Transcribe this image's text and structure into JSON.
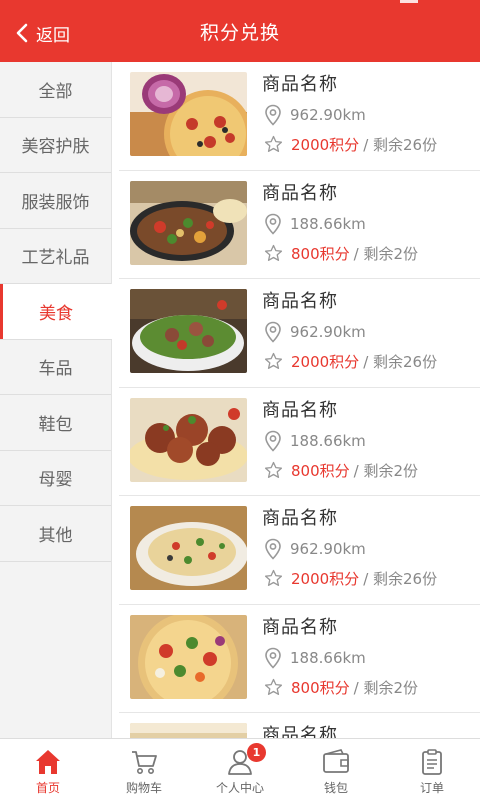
{
  "header": {
    "back_label": "返回",
    "title": "积分兑换"
  },
  "sidebar": {
    "items": [
      {
        "label": "全部"
      },
      {
        "label": "美容护肤"
      },
      {
        "label": "服装服饰"
      },
      {
        "label": "工艺礼品"
      },
      {
        "label": "美食",
        "active": true
      },
      {
        "label": "车品"
      },
      {
        "label": "鞋包"
      },
      {
        "label": "母婴"
      },
      {
        "label": "其他"
      }
    ]
  },
  "products": [
    {
      "name": "商品名称",
      "distance": "962.90km",
      "points": "2000积分",
      "stock": "/ 剩余26份",
      "image": "pizza-onion"
    },
    {
      "name": "商品名称",
      "distance": "188.66km",
      "points": "800积分",
      "stock": "/ 剩余2份",
      "image": "pan-stirfry"
    },
    {
      "name": "商品名称",
      "distance": "962.90km",
      "points": "2000积分",
      "stock": "/ 剩余26份",
      "image": "salad-bowl"
    },
    {
      "name": "商品名称",
      "distance": "188.66km",
      "points": "800积分",
      "stock": "/ 剩余2份",
      "image": "meatball-pasta"
    },
    {
      "name": "商品名称",
      "distance": "962.90km",
      "points": "2000积分",
      "stock": "/ 剩余26份",
      "image": "pasta-plate"
    },
    {
      "name": "商品名称",
      "distance": "188.66km",
      "points": "800积分",
      "stock": "/ 剩余2份",
      "image": "veg-pizza"
    },
    {
      "name": "商品名称",
      "distance": "",
      "points": "",
      "stock": "",
      "image": "partial"
    }
  ],
  "tabbar": {
    "tabs": [
      {
        "label": "首页",
        "icon": "home-icon",
        "active": true
      },
      {
        "label": "购物车",
        "icon": "cart-icon"
      },
      {
        "label": "个人中心",
        "icon": "user-icon",
        "badge": "1"
      },
      {
        "label": "钱包",
        "icon": "wallet-icon"
      },
      {
        "label": "订单",
        "icon": "order-icon"
      }
    ]
  },
  "colors": {
    "accent": "#e8382f",
    "sidebar_bg": "#f3f3f3",
    "text_gray": "#888888"
  }
}
